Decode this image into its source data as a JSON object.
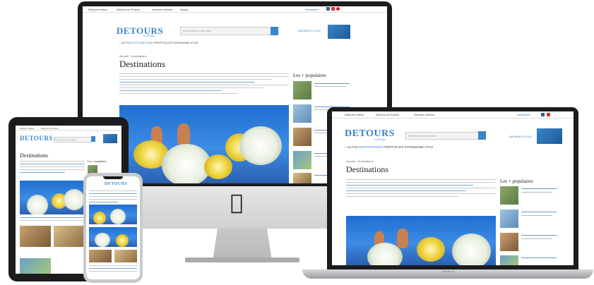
{
  "site": {
    "logo": "DETOURS",
    "logo_sub": "en France",
    "topbar": [
      "Détours malins",
      "Détours en France",
      "Gamme voitures",
      "Epoqu"
    ],
    "topbar_right": "Newsletter",
    "search_placeholder": "Recherchez votre idée",
    "subscribe": "ABONNEZ-VOUS",
    "nav": [
      "ACTUS",
      "DESTINATIONS",
      "PORTFOLIOS",
      "PATRIMOINE",
      "VTUS"
    ],
    "breadcrumb": "Accueil · Destinations",
    "title": "Destinations",
    "sidebar_title": "Les + populaires",
    "sidebar_items": [
      "Les plus belles plages de Bretagne",
      "La Seine à vélo en Normandie",
      "Les plus beaux villages du Gers",
      "Les plus belles plages de Marseille",
      "Les plus beaux"
    ]
  },
  "devices": {
    "laptop_brand": "MacBook",
    "imac_logo": ""
  },
  "colors": {
    "brand": "#3a86c8",
    "device": "#1c1c1e",
    "silver": "#c9cacc"
  },
  "icons": [
    "apple-logo-icon",
    "search-icon",
    "home-icon",
    "facebook-icon",
    "youtube-icon",
    "pinterest-icon",
    "instagram-icon"
  ]
}
